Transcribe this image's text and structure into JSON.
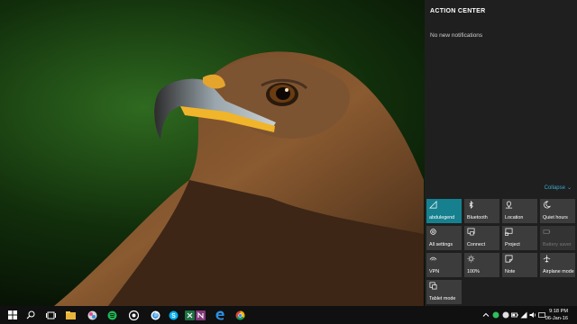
{
  "action_center": {
    "title": "ACTION CENTER",
    "no_notifications": "No new notifications",
    "collapse_label": "Collapse",
    "tiles": [
      {
        "label": "abdulegend",
        "icon": "wifi-icon",
        "state": "on"
      },
      {
        "label": "Bluetooth",
        "icon": "bluetooth-icon",
        "state": "off"
      },
      {
        "label": "Location",
        "icon": "location-icon",
        "state": "off"
      },
      {
        "label": "Quiet hours",
        "icon": "moon-icon",
        "state": "off"
      },
      {
        "label": "All settings",
        "icon": "gear-icon",
        "state": "off"
      },
      {
        "label": "Connect",
        "icon": "connect-icon",
        "state": "off"
      },
      {
        "label": "Project",
        "icon": "project-icon",
        "state": "off"
      },
      {
        "label": "Battery saver",
        "icon": "battery-icon",
        "state": "disabled"
      },
      {
        "label": "VPN",
        "icon": "vpn-icon",
        "state": "off"
      },
      {
        "label": "100%",
        "icon": "brightness-icon",
        "state": "off"
      },
      {
        "label": "Note",
        "icon": "note-icon",
        "state": "off"
      },
      {
        "label": "Airplane mode",
        "icon": "airplane-icon",
        "state": "off"
      },
      {
        "label": "Tablet mode",
        "icon": "tablet-icon",
        "state": "off"
      }
    ]
  },
  "taskbar": {
    "time": "9:18 PM",
    "date": "06-Jan-16",
    "apps": [
      "start-icon",
      "search-icon",
      "task-view-icon",
      "file-explorer-icon",
      "media-player-icon",
      "spotify-icon",
      "groove-icon",
      "itunes-icon",
      "skype-icon",
      "excel-icon",
      "onenote-icon",
      "edge-icon",
      "edge-beta-icon",
      "chrome-icon"
    ]
  },
  "colors": {
    "accent": "#16808f",
    "panel": "#1f1f1f",
    "tile": "#3c3c3c",
    "taskbar": "#101010",
    "link": "#3aa8c8"
  }
}
